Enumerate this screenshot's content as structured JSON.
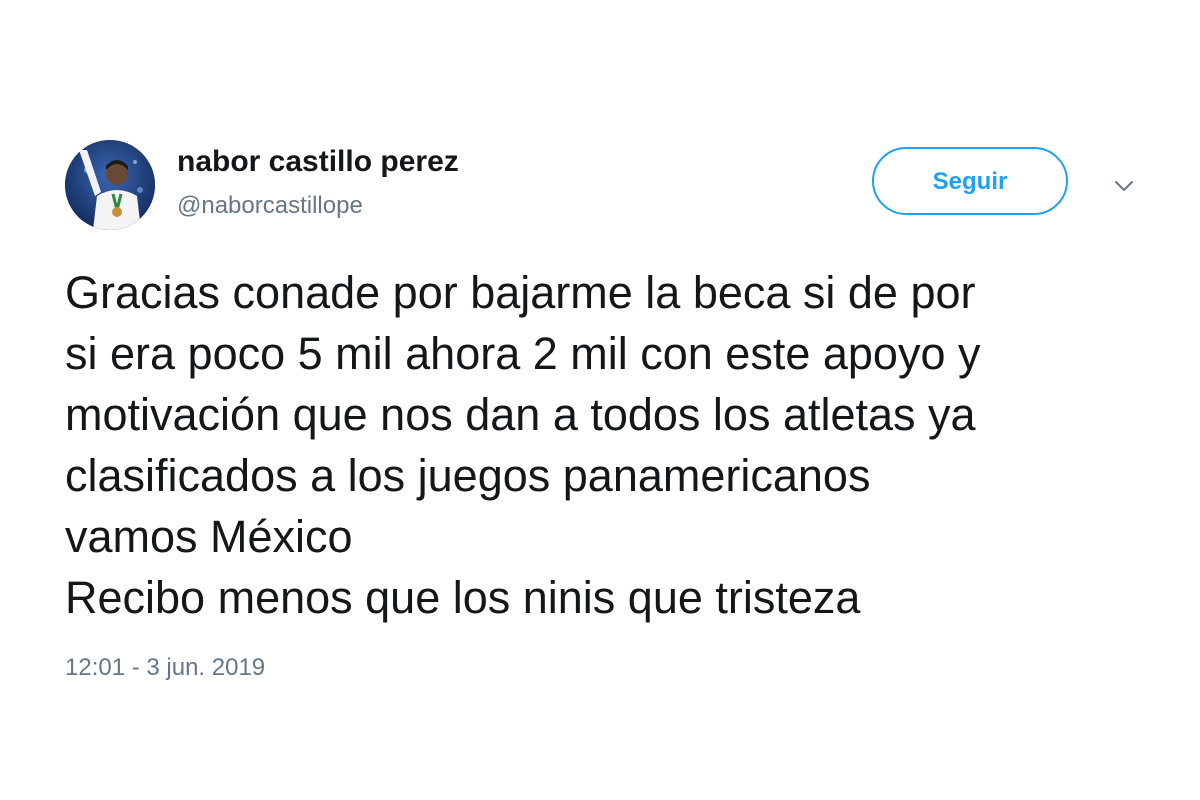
{
  "tweet": {
    "author": {
      "display_name": "nabor castillo perez",
      "handle": "@naborcastillope",
      "avatar_icon": "profile-photo"
    },
    "follow_label": "Seguir",
    "menu_icon": "chevron-down-icon",
    "text_lines": [
      "Gracias conade por bajarme la beca si de por",
      "si era poco 5 mil ahora 2 mil con este apoyo y",
      "motivación que nos dan a todos los atletas ya",
      "clasificados a los juegos panamericanos",
      "vamos México",
      "Recibo menos que los ninis que tristeza"
    ],
    "timestamp": "12:01 - 3 jun. 2019"
  },
  "colors": {
    "accent": "#1da1f2",
    "text": "#14171a",
    "secondary_text": "#657786",
    "background": "#ffffff"
  }
}
